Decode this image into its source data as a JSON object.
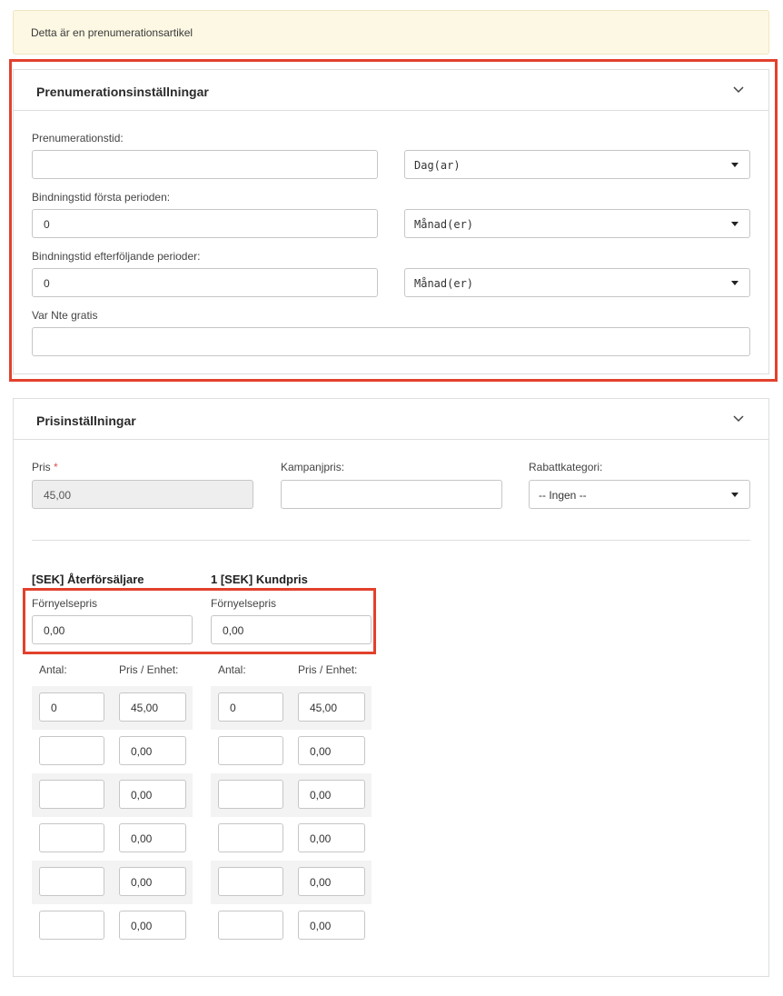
{
  "notice": "Detta är en prenumerationsartikel",
  "subscription": {
    "title": "Prenumerationsinställningar",
    "period_label": "Prenumerationstid:",
    "period_value": "",
    "period_unit": "Dag(ar)",
    "binding_first_label": "Bindningstid första perioden:",
    "binding_first_value": "0",
    "binding_first_unit": "Månad(er)",
    "binding_next_label": "Bindningstid efterföljande perioder:",
    "binding_next_value": "0",
    "binding_next_unit": "Månad(er)",
    "nth_free_label": "Var Nte gratis",
    "nth_free_value": ""
  },
  "pricing": {
    "title": "Prisinställningar",
    "price_label": "Pris",
    "required_mark": "*",
    "price_value": "45,00",
    "campaign_label": "Kampanjpris:",
    "campaign_value": "",
    "discount_label": "Rabattkategori:",
    "discount_value": "-- Ingen --",
    "groups": [
      {
        "title": "[SEK] Återförsäljare",
        "renewal_label": "Förnyelsepris",
        "renewal_value": "0,00",
        "qty_header": "Antal:",
        "unit_header": "Pris / Enhet:",
        "tiers": [
          {
            "qty": "0",
            "price": "45,00"
          },
          {
            "qty": "",
            "price": "0,00"
          },
          {
            "qty": "",
            "price": "0,00"
          },
          {
            "qty": "",
            "price": "0,00"
          },
          {
            "qty": "",
            "price": "0,00"
          },
          {
            "qty": "",
            "price": "0,00"
          }
        ]
      },
      {
        "title": "1 [SEK] Kundpris",
        "renewal_label": "Förnyelsepris",
        "renewal_value": "0,00",
        "qty_header": "Antal:",
        "unit_header": "Pris / Enhet:",
        "tiers": [
          {
            "qty": "0",
            "price": "45,00"
          },
          {
            "qty": "",
            "price": "0,00"
          },
          {
            "qty": "",
            "price": "0,00"
          },
          {
            "qty": "",
            "price": "0,00"
          },
          {
            "qty": "",
            "price": "0,00"
          },
          {
            "qty": "",
            "price": "0,00"
          }
        ]
      }
    ]
  },
  "colors": {
    "highlight": "#e2412d",
    "notice_bg": "#fcf8e3",
    "required": "#d9534f"
  }
}
